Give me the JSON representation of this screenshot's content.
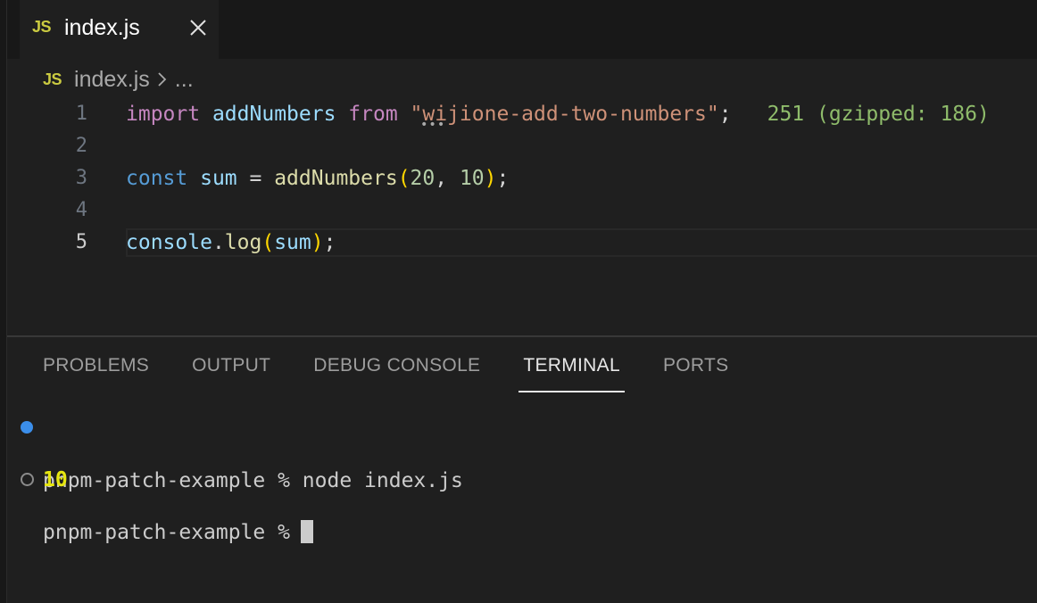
{
  "tab": {
    "lang_badge": "JS",
    "file_name": "index.js"
  },
  "breadcrumb": {
    "lang_badge": "JS",
    "file_name": "index.js",
    "more": "..."
  },
  "editor": {
    "line_numbers": [
      "1",
      "2",
      "3",
      "4",
      "5"
    ],
    "line1": {
      "import": "import",
      "name": "addNumbers",
      "from": "from",
      "module": "\"wijione-add-two-numbers\"",
      "semi": ";",
      "size_hint": "251 (gzipped: 186)"
    },
    "line3": {
      "const": "const",
      "var": "sum",
      "eq": " = ",
      "fn": "addNumbers",
      "open": "(",
      "a": "20",
      "comma": ", ",
      "b": "10",
      "close": ")",
      "semi": ";"
    },
    "line5": {
      "obj": "console",
      "dot": ".",
      "method": "log",
      "open": "(",
      "arg": "sum",
      "close": ")",
      "semi": ";"
    }
  },
  "panel": {
    "tabs": [
      "PROBLEMS",
      "OUTPUT",
      "DEBUG CONSOLE",
      "TERMINAL",
      "PORTS"
    ],
    "active_tab": "TERMINAL"
  },
  "terminal": {
    "line1": "pnpm-patch-example % node index.js",
    "output": "10",
    "prompt": "pnpm-patch-example %"
  },
  "colors": {
    "accent": "#3b8eea",
    "js_badge": "#cbcb41",
    "output": "#e5e510"
  }
}
